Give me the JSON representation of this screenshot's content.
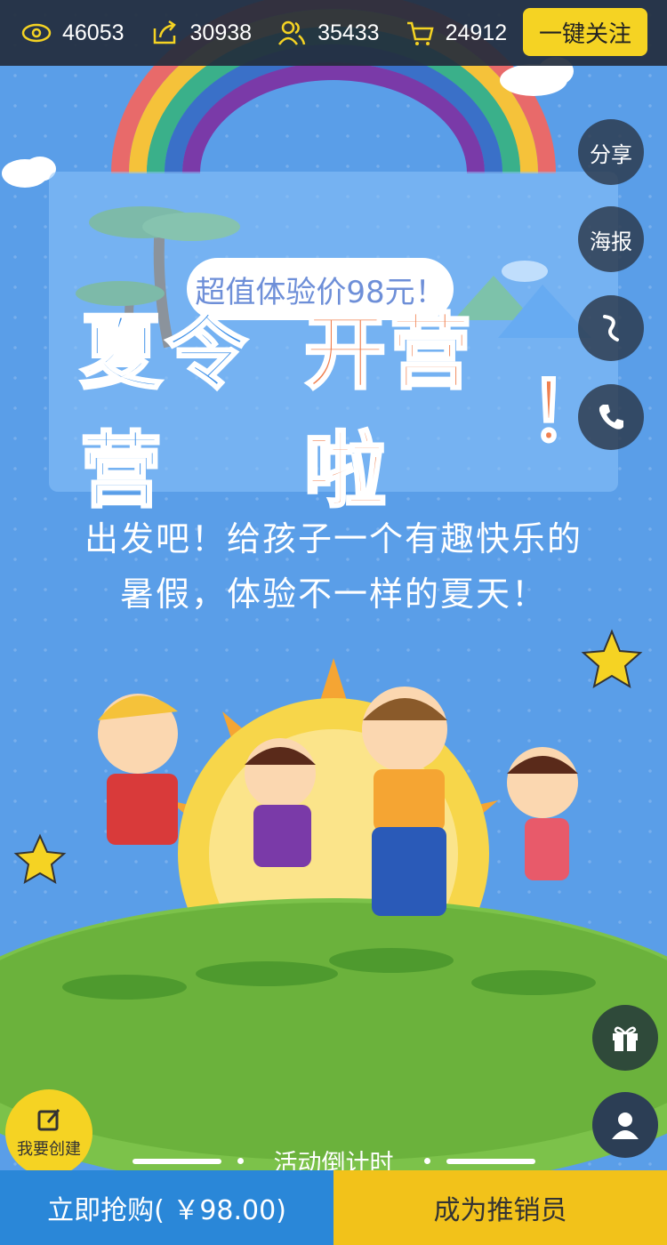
{
  "stats": [
    {
      "icon": "eye-icon",
      "value": "46053"
    },
    {
      "icon": "share-arrow-icon",
      "value": "30938"
    },
    {
      "icon": "users-icon",
      "value": "35433"
    },
    {
      "icon": "cart-icon",
      "value": "24912"
    }
  ],
  "follow_label": "一键关注",
  "side": {
    "share_label": "分享",
    "poster_label": "海报",
    "music_icon": "music-icon",
    "phone_icon": "phone-icon"
  },
  "banner": {
    "price_text": "超值体验价98元！",
    "title_part1": "夏令营",
    "title_part2": "开营啦",
    "title_part3": "！"
  },
  "slogan": {
    "line1": "出发吧！给孩子一个有趣快乐的",
    "line2": "暑假，体验不一样的夏天！"
  },
  "create_label": "我要创建",
  "countdown_label": "活动倒计时",
  "bottom": {
    "buy_label": "立即抢购( ￥98.00)",
    "promoter_label": "成为推销员"
  },
  "colors": {
    "background": "#5a9ee8",
    "accent_yellow": "#f5d323",
    "buy_blue": "#2a87d8"
  }
}
